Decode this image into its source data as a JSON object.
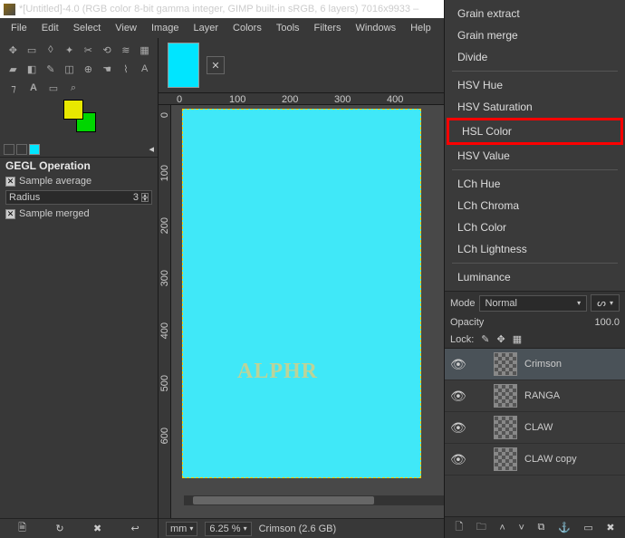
{
  "title": "*[Untitled]-4.0 (RGB color 8-bit gamma integer, GIMP built-in sRGB, 6 layers) 7016x9933 –",
  "menu": [
    "File",
    "Edit",
    "Select",
    "View",
    "Image",
    "Layer",
    "Colors",
    "Tools",
    "Filters",
    "Windows",
    "Help"
  ],
  "tool_options": {
    "title": "GEGL Operation",
    "sample_average": "Sample average",
    "radius_label": "Radius",
    "radius_value": "3",
    "sample_merged": "Sample merged"
  },
  "ruler_h": [
    "0",
    "100",
    "200",
    "300",
    "400"
  ],
  "ruler_v": [
    "0",
    "100",
    "200",
    "300",
    "400",
    "500",
    "600"
  ],
  "canvas": {
    "watermark": "ALPHR"
  },
  "status": {
    "unit": "mm",
    "zoom": "6.25 %",
    "info": "Crimson (2.6 GB)"
  },
  "blend_modes": {
    "group1": [
      "Grain extract",
      "Grain merge",
      "Divide"
    ],
    "group2": [
      "HSV Hue",
      "HSV Saturation"
    ],
    "highlighted": "HSL Color",
    "after": [
      "HSV Value"
    ],
    "group3": [
      "LCh Hue",
      "LCh Chroma",
      "LCh Color",
      "LCh Lightness"
    ],
    "group4": [
      "Luminance"
    ]
  },
  "mode": {
    "label": "Mode",
    "value": "Normal"
  },
  "opacity": {
    "label": "Opacity",
    "value": "100.0"
  },
  "lock": {
    "label": "Lock:"
  },
  "layers": [
    {
      "name": "Crimson",
      "visible": true,
      "selected": true
    },
    {
      "name": "RANGA",
      "visible": true
    },
    {
      "name": "CLAW",
      "visible": true
    },
    {
      "name": "CLAW copy",
      "visible": true
    }
  ]
}
